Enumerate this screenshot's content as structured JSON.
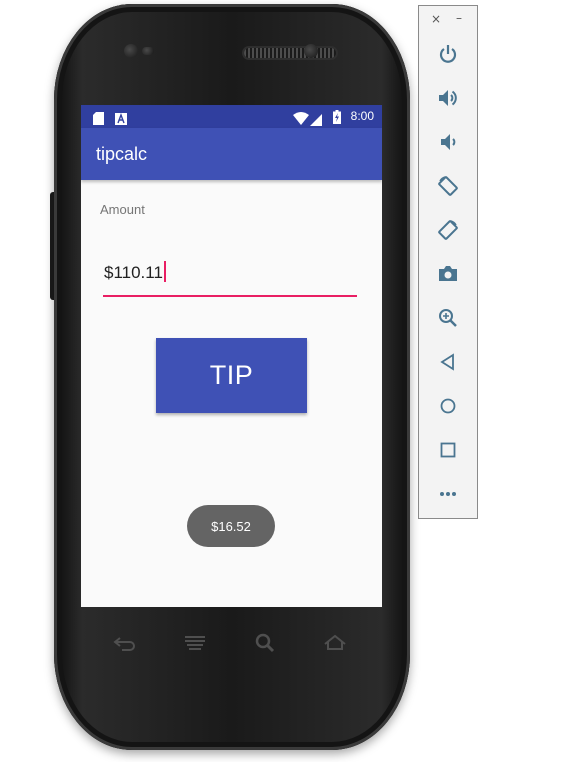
{
  "status_bar": {
    "time": "8:00",
    "icons": [
      "sd-card-icon",
      "a-notification-icon",
      "wifi-icon",
      "cell-signal-icon",
      "battery-charging-icon"
    ]
  },
  "app": {
    "title": "tipcalc",
    "amount_label": "Amount",
    "amount_value": "$110.11",
    "tip_button_label": "TIP",
    "toast_text": "$16.52"
  },
  "colors": {
    "status_bar": "#303f9f",
    "app_bar": "#3f51b5",
    "accent": "#e91e63",
    "toast": "#646464"
  },
  "hardware_keys": [
    "back-icon",
    "menu-icon",
    "search-icon",
    "home-icon"
  ],
  "emulator_toolbar": {
    "window_controls": [
      "close-icon",
      "minimize-icon"
    ],
    "buttons": [
      "power-icon",
      "volume-up-icon",
      "volume-down-icon",
      "rotate-left-icon",
      "rotate-right-icon",
      "camera-icon",
      "zoom-icon",
      "back-icon",
      "home-icon",
      "overview-icon",
      "more-icon"
    ],
    "window_close_glyph": "×",
    "window_min_glyph": "–"
  }
}
